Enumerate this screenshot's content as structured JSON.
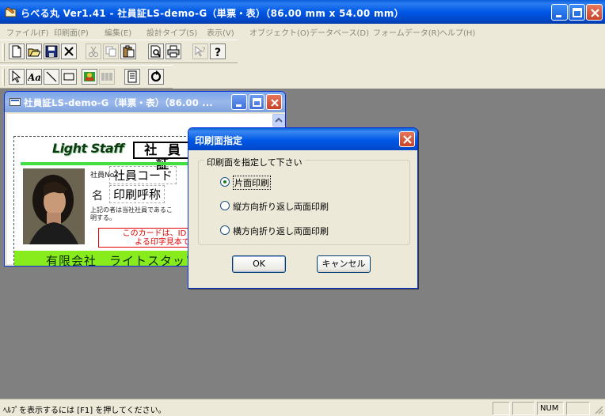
{
  "app": {
    "title": "らべる丸 Ver1.41 - 社員証LS-demo-G（単票・表）（86.00 mm x 54.00 mm）"
  },
  "menu": [
    {
      "label": "ファイル(F)"
    },
    {
      "label": "印刷面(P)"
    },
    {
      "label": "編集(E)"
    },
    {
      "label": "設計タイプ(S)"
    },
    {
      "label": "表示(V)"
    },
    {
      "label": "オブジェクト(O)"
    },
    {
      "label": "データベース(D)"
    },
    {
      "label": "フォームデータ(R)"
    },
    {
      "label": "ヘルプ(H)"
    }
  ],
  "toolbar1": [
    "new-icon",
    "open-icon",
    "save-icon",
    "delete-icon",
    "cut-icon",
    "copy-icon",
    "paste-icon",
    "print-preview-icon",
    "print-icon",
    "context-help-icon",
    "help-icon"
  ],
  "toolbar2": [
    "select-arrow-icon",
    "text-tool-icon",
    "line-tool-icon",
    "rect-tool-icon",
    "image-tool-icon",
    "barcode-tool-icon",
    "list-icon",
    "refresh-icon"
  ],
  "child": {
    "title": "社員証LS-demo-G（単票・表）（86.00 ..."
  },
  "card": {
    "brand": "Light Staff",
    "heading": "社 員 証",
    "label_no": "社員No",
    "field_code": "社員コード",
    "label_name": "名",
    "field_name": "印刷呼称",
    "statement_line1": "上記の者は当社社員であるこ",
    "statement_line2": "明する。",
    "notice_line1": "このカードは、IDメイト",
    "notice_line2": "よる印字見本です",
    "company": "有限会社　ライトスタッフ"
  },
  "dialog": {
    "title": "印刷面指定",
    "group_label": "印刷面を指定して下さい",
    "options": [
      {
        "label": "片面印刷",
        "selected": true
      },
      {
        "label": "縦方向折り返し両面印刷",
        "selected": false
      },
      {
        "label": "横方向折り返し両面印刷",
        "selected": false
      }
    ],
    "ok_label": "OK",
    "cancel_label": "キャンセル"
  },
  "status": {
    "message": "ﾍﾙﾌﾟを表示するには [F1] を押してください。",
    "num": "NUM"
  },
  "colors": {
    "titlebar": "#0058e6",
    "workspace": "#808080",
    "card_band": "#88ec1c",
    "notice": "#e00000"
  }
}
